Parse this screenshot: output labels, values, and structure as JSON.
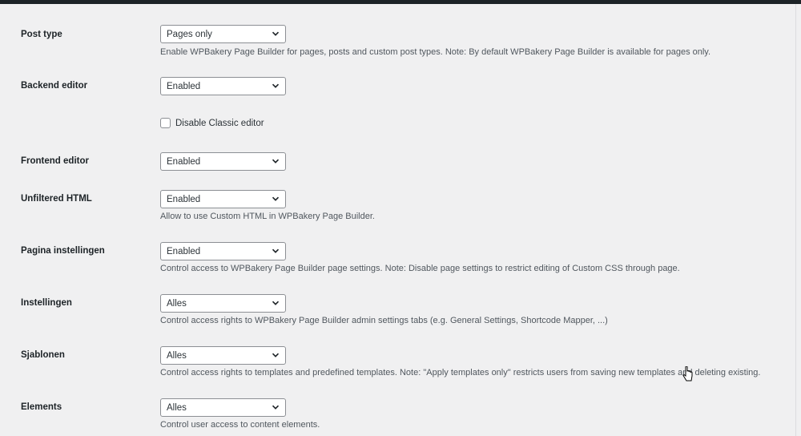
{
  "settings": {
    "post_type": {
      "label": "Post type",
      "value": "Pages only",
      "description": "Enable WPBakery Page Builder for pages, posts and custom post types. Note: By default WPBakery Page Builder is available for pages only."
    },
    "backend_editor": {
      "label": "Backend editor",
      "value": "Enabled",
      "checkbox_label": "Disable Classic editor",
      "checkbox_checked": false
    },
    "frontend_editor": {
      "label": "Frontend editor",
      "value": "Enabled"
    },
    "unfiltered_html": {
      "label": "Unfiltered HTML",
      "value": "Enabled",
      "description": "Allow to use Custom HTML in WPBakery Page Builder."
    },
    "pagina_instellingen": {
      "label": "Pagina instellingen",
      "value": "Enabled",
      "description": "Control access to WPBakery Page Builder page settings. Note: Disable page settings to restrict editing of Custom CSS through page."
    },
    "instellingen": {
      "label": "Instellingen",
      "value": "Alles",
      "description": "Control access rights to WPBakery Page Builder admin settings tabs (e.g. General Settings, Shortcode Mapper, ...)"
    },
    "sjablonen": {
      "label": "Sjablonen",
      "value": "Alles",
      "description": "Control access rights to templates and predefined templates. Note: \"Apply templates only\" restricts users from saving new templates and deleting existing."
    },
    "elements": {
      "label": "Elements",
      "value": "Alles",
      "description": "Control user access to content elements."
    }
  },
  "icons": {
    "dropdown": "chevron-down-icon",
    "pointer": "mouse-pointer-icon"
  },
  "colors": {
    "background": "#f0f0f1",
    "topbar": "#1d2327",
    "input_border": "#8c8f94",
    "description_text": "#50575e"
  }
}
